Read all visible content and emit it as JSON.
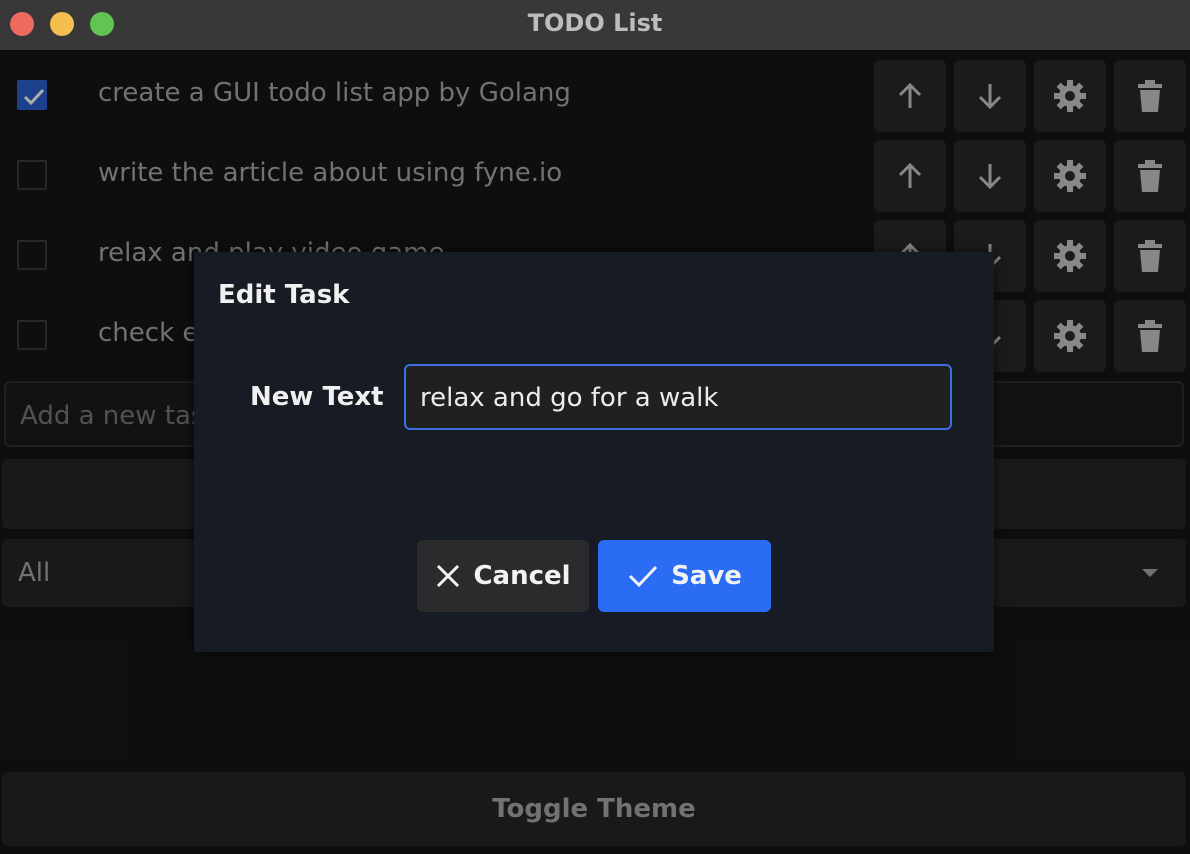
{
  "window": {
    "title": "TODO List"
  },
  "tasks": [
    {
      "text": "create a GUI todo list app by Golang",
      "done": true
    },
    {
      "text": "write the article about using fyne.io",
      "done": false
    },
    {
      "text": "relax and play video game",
      "done": false
    },
    {
      "text": "check e",
      "done": false
    }
  ],
  "new_task": {
    "placeholder": "Add a new tas"
  },
  "filter": {
    "selected": "All"
  },
  "toggle_theme": {
    "label": "Toggle Theme"
  },
  "dialog": {
    "title": "Edit Task",
    "field_label": "New Text",
    "field_value": "relax and go for a walk",
    "cancel_label": "Cancel",
    "save_label": "Save"
  },
  "colors": {
    "accent": "#2b6cf5",
    "checked": "#2b5fd0",
    "dialog_bg": "#171b24",
    "background": "#161616"
  },
  "icons": [
    "arrow-up-icon",
    "arrow-down-icon",
    "gear-icon",
    "trash-icon",
    "close-icon",
    "checkmark-icon"
  ]
}
